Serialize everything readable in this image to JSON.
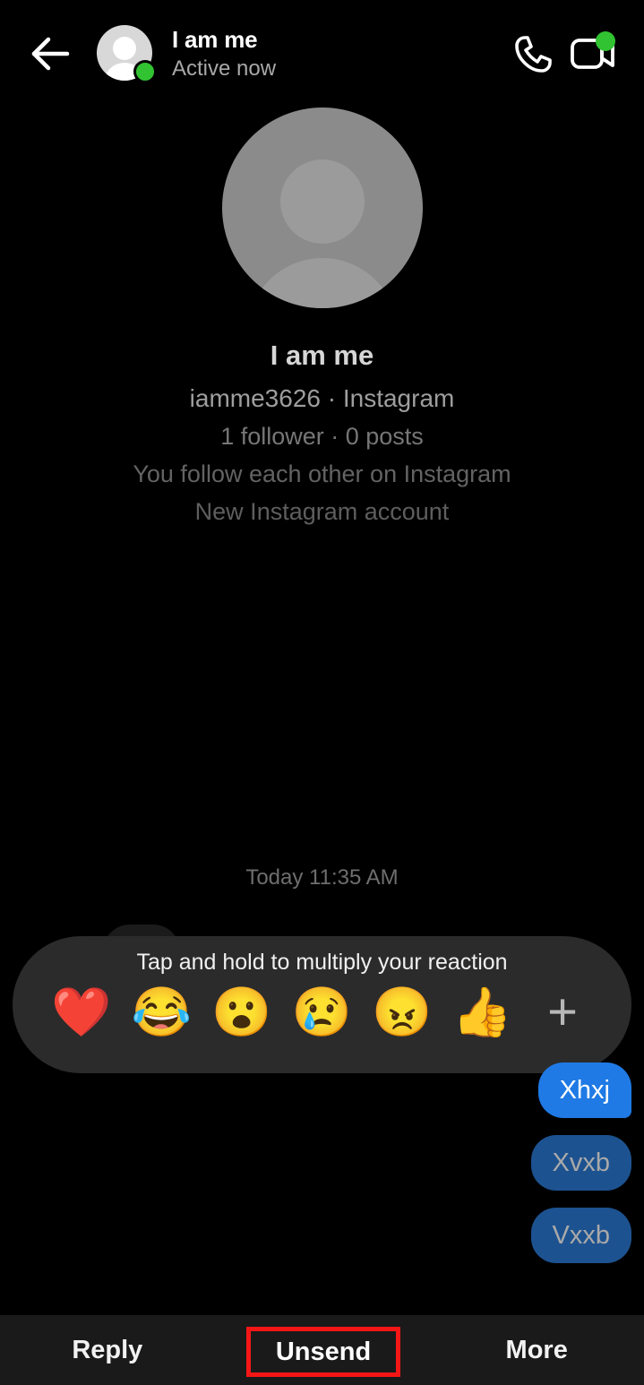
{
  "header": {
    "back_icon": "back-arrow-icon",
    "title": "I am me",
    "subtitle": "Active now",
    "avatar_icon": "person-avatar-icon",
    "online_status": "online",
    "call_icon": "phone-call-icon",
    "video_icon": "video-camera-icon"
  },
  "profile": {
    "avatar_icon": "default-person-avatar",
    "name": "I am me",
    "handle": "iamme3626 · Instagram",
    "stats": "1 follower · 0 posts",
    "relation": "You follow each other on Instagram",
    "note": "New Instagram account"
  },
  "conversation": {
    "timestamp": "Today 11:35 AM",
    "messages": [
      {
        "text": "Xhxj",
        "side": "outgoing",
        "state": "selected"
      },
      {
        "text": "Xvxb",
        "side": "outgoing",
        "state": "dimmed"
      },
      {
        "text": "Vxxb",
        "side": "outgoing",
        "state": "dimmed"
      }
    ]
  },
  "reaction_bar": {
    "hint": "Tap and hold to multiply your reaction",
    "reactions": [
      {
        "name": "heart-reaction",
        "glyph": "❤️"
      },
      {
        "name": "laughing-reaction",
        "glyph": "😂"
      },
      {
        "name": "wow-reaction",
        "glyph": "😮"
      },
      {
        "name": "sad-reaction",
        "glyph": "😢"
      },
      {
        "name": "angry-reaction",
        "glyph": "😠"
      },
      {
        "name": "thumbs-up-reaction",
        "glyph": "👍"
      },
      {
        "name": "more-reactions",
        "glyph": "+"
      }
    ]
  },
  "action_bar": {
    "reply_label": "Reply",
    "unsend_label": "Unsend",
    "more_label": "More"
  },
  "colors": {
    "background": "#000000",
    "bubble_active": "#1f7ae5",
    "bubble_dim": "#1d5290",
    "reaction_bar": "#2b2b2b",
    "action_bar": "#1a1a1a",
    "online_dot": "#31c331",
    "highlight_box": "#f51616"
  }
}
